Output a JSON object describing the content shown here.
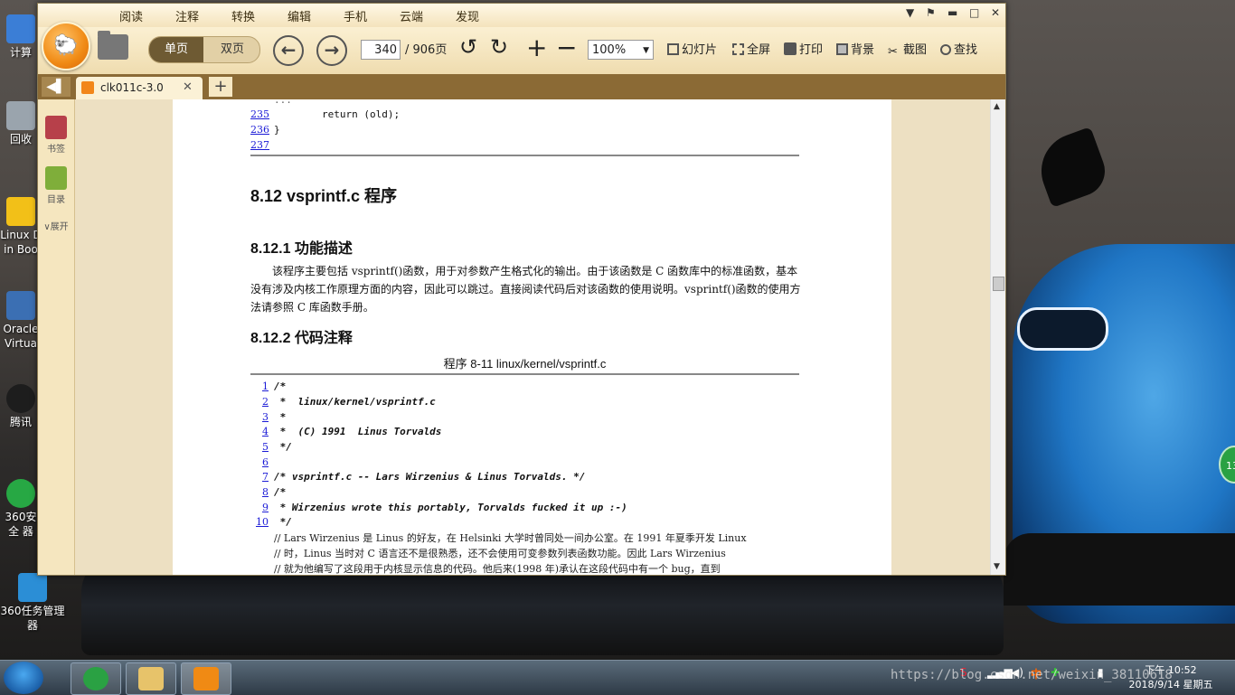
{
  "desktop": {
    "icons": [
      {
        "label": "计算",
        "color": "#3b7ed6"
      },
      {
        "label": "回收",
        "color": "#9aa4ad"
      },
      {
        "label": "Linux D in Boo",
        "color": "#f2c018"
      },
      {
        "label": "Oracle Virtua",
        "color": "#3b6fb3"
      },
      {
        "label": "腾讯",
        "color": "#1d1d1d"
      },
      {
        "label": "360安全 器",
        "color": "#27a844"
      },
      {
        "label": "360任务管理 器",
        "color": "#2b8ed6"
      }
    ],
    "side_badge": "13"
  },
  "app": {
    "menu": [
      "阅读",
      "注释",
      "转换",
      "编辑",
      "手机",
      "云端",
      "发现"
    ],
    "window_controls": {
      "menu": "▼",
      "skin": "⚑",
      "minimize": "▬",
      "maximize": "□",
      "close": "✕"
    },
    "toolbar": {
      "single_page": "单页",
      "double_page": "双页",
      "prev": "←",
      "next": "→",
      "current_page": "340",
      "total_pages": "/ 906页",
      "rotate_left": "↺",
      "rotate_right": "↻",
      "zoom_in": "+",
      "zoom_out": "−",
      "zoom_value": "100%",
      "slideshow": "幻灯片",
      "fullscreen": "全屏",
      "print": "打印",
      "background": "背景",
      "screenshot": "截图",
      "find": "查找"
    },
    "tab": {
      "back": "◀▌",
      "title": "clk011c-3.0",
      "close": "✕",
      "add": "+"
    },
    "sidebar": {
      "bookmarks": "书签",
      "toc": "目录",
      "expand": "展开"
    }
  },
  "document": {
    "top_code": [
      {
        "n": "235",
        "text": "        return (old);"
      },
      {
        "n": "236",
        "text": "}"
      },
      {
        "n": "237",
        "text": ""
      }
    ],
    "section_title": "8.12 vsprintf.c 程序",
    "sub1_title": "8.12.1 功能描述",
    "sub1_para": "该程序主要包括 vsprintf()函数，用于对参数产生格式化的输出。由于该函数是 C 函数库中的标准函数，基本没有涉及内核工作原理方面的内容，因此可以跳过。直接阅读代码后对该函数的使用说明。vsprintf()函数的使用方法请参照 C 库函数手册。",
    "sub2_title": "8.12.2 代码注释",
    "listing_caption": "程序 8-11 linux/kernel/vsprintf.c",
    "listing": [
      {
        "n": "1",
        "text": "/*"
      },
      {
        "n": "2",
        "text": " *  linux/kernel/vsprintf.c"
      },
      {
        "n": "3",
        "text": " *"
      },
      {
        "n": "4",
        "text": " *  (C) 1991  Linus Torvalds"
      },
      {
        "n": "5",
        "text": " */"
      },
      {
        "n": "6",
        "text": ""
      },
      {
        "n": "7",
        "text": "/* vsprintf.c -- Lars Wirzenius & Linus Torvalds. */"
      },
      {
        "n": "8",
        "text": "/*"
      },
      {
        "n": "9",
        "text": " * Wirzenius wrote this portably, Torvalds fucked it up :-)"
      },
      {
        "n": "10",
        "text": " */"
      }
    ],
    "comments": [
      "// Lars Wirzenius 是 Linus 的好友，在 Helsinki 大学时曾同处一间办公室。在 1991 年夏季开发 Linux",
      "// 时，Linus 当时对 C 语言还不是很熟悉，还不会使用可变参数列表函数功能。因此 Lars Wirzenius",
      "// 就为他编写了这段用于内核显示信息的代码。他后来(1998 年)承认在这段代码中有一个 bug，直到"
    ]
  },
  "taskbar": {
    "clock_time": "下午 10:52",
    "clock_date": "2018/9/14 星期五",
    "ime": "中",
    "watermark": "https://blog.csdn.net/weixin_38110618"
  }
}
